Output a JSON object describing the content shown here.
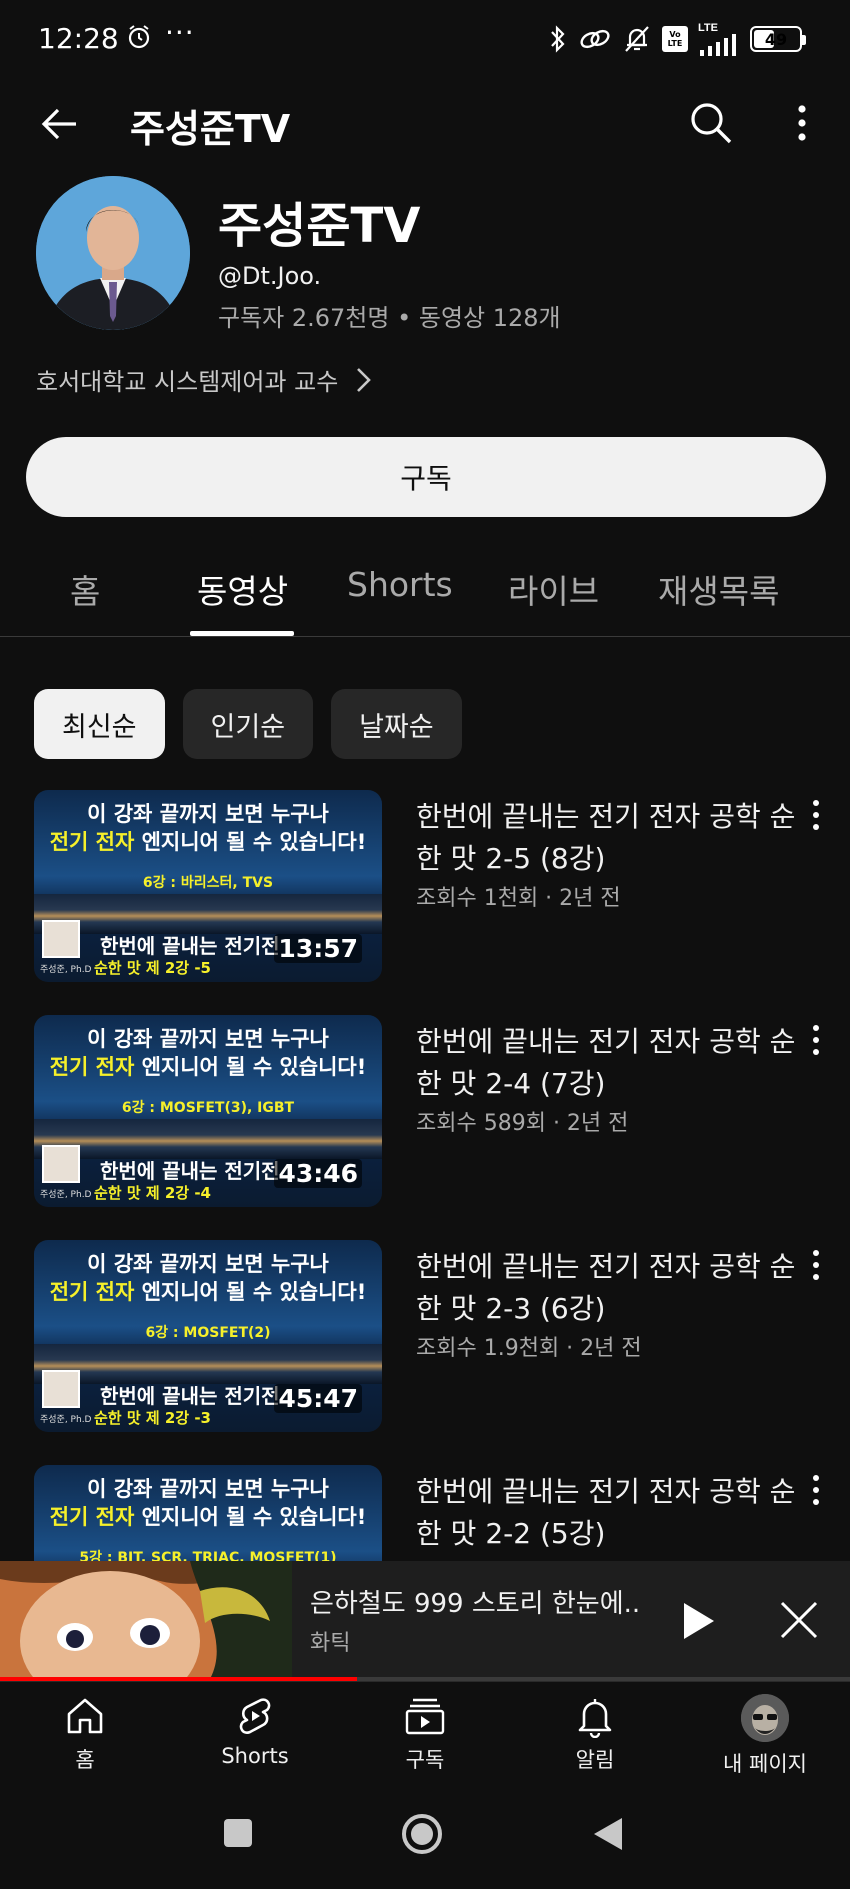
{
  "status_bar": {
    "time": "12:28",
    "dots": "···",
    "network": "LTE",
    "volte": "Vo LTE",
    "battery": "49"
  },
  "app_bar": {
    "title": "주성준TV"
  },
  "channel": {
    "name": "주성준TV",
    "handle": "@Dt.Joo.",
    "stats": "구독자 2.67천명 • 동영상 128개",
    "description": "호서대학교 시스템제어과 교수",
    "subscribe_label": "구독"
  },
  "tabs": [
    {
      "label": "홈",
      "active": false
    },
    {
      "label": "동영상",
      "active": true
    },
    {
      "label": "Shorts",
      "active": false
    },
    {
      "label": "라이브",
      "active": false
    },
    {
      "label": "재생목록",
      "active": false
    }
  ],
  "filter_chips": [
    {
      "label": "최신순",
      "selected": true
    },
    {
      "label": "인기순",
      "selected": false
    },
    {
      "label": "날짜순",
      "selected": false
    }
  ],
  "videos": [
    {
      "thumb_line1": "이 강좌 끝까지 보면 누구나",
      "thumb_line2_highlight": "전기 전자",
      "thumb_line2_rest": " 엔지니어 될 수 있습니다!",
      "thumb_topic": "6강 : 바리스터, TVS",
      "thumb_caption": "한번에 끝내는 전기전",
      "thumb_subcaption": "순한 맛 제 2강 -5",
      "face_caption": "주성준, Ph.D",
      "duration": "13:57",
      "title": "한번에 끝내는 전기 전자 공학 순한 맛 2-5  (8강)",
      "meta": "조회수 1천회 · 2년 전"
    },
    {
      "thumb_line1": "이 강좌 끝까지 보면 누구나",
      "thumb_line2_highlight": "전기 전자",
      "thumb_line2_rest": " 엔지니어 될 수 있습니다!",
      "thumb_topic": "6강 : MOSFET(3), IGBT",
      "thumb_caption": "한번에 끝내는 전기전",
      "thumb_subcaption": "순한 맛 제 2강 -4",
      "face_caption": "주성준, Ph.D",
      "duration": "43:46",
      "title": "한번에 끝내는 전기 전자 공학 순한 맛 2-4  (7강)",
      "meta": "조회수 589회 · 2년 전"
    },
    {
      "thumb_line1": "이 강좌 끝까지 보면 누구나",
      "thumb_line2_highlight": "전기 전자",
      "thumb_line2_rest": " 엔지니어 될 수 있습니다!",
      "thumb_topic": "6강 : MOSFET(2)",
      "thumb_caption": "한번에 끝내는 전기전",
      "thumb_subcaption": "순한 맛 제 2강 -3",
      "face_caption": "주성준, Ph.D",
      "duration": "45:47",
      "title": "한번에 끝내는 전기 전자 공학 순한 맛 2-3  (6강)",
      "meta": "조회수 1.9천회 · 2년 전"
    },
    {
      "thumb_line1": "이 강좌 끝까지 보면 누구나",
      "thumb_line2_highlight": "전기 전자",
      "thumb_line2_rest": " 엔지니어 될 수 있습니다!",
      "thumb_topic": "5강 : BJT, SCR, TRIAC, MOSFET(1)",
      "thumb_caption": "",
      "thumb_subcaption": "",
      "face_caption": "",
      "duration": "",
      "title": "한번에 끝내는 전기 전자 공학 순한 맛 2-2 (5강)",
      "meta": ""
    }
  ],
  "mini_player": {
    "title": "은하철도 999 스토리 한눈에..",
    "channel": "화틱",
    "progress": 0.42
  },
  "bottom_nav": [
    {
      "label": "홈",
      "icon": "home-icon"
    },
    {
      "label": "Shorts",
      "icon": "shorts-icon"
    },
    {
      "label": "구독",
      "icon": "subscriptions-icon"
    },
    {
      "label": "알림",
      "icon": "bell-icon"
    },
    {
      "label": "내 페이지",
      "icon": "avatar"
    }
  ],
  "colors": {
    "background": "#0f0f0f",
    "progress_red": "#ff0000",
    "thumb_yellow": "#f6f02a"
  }
}
